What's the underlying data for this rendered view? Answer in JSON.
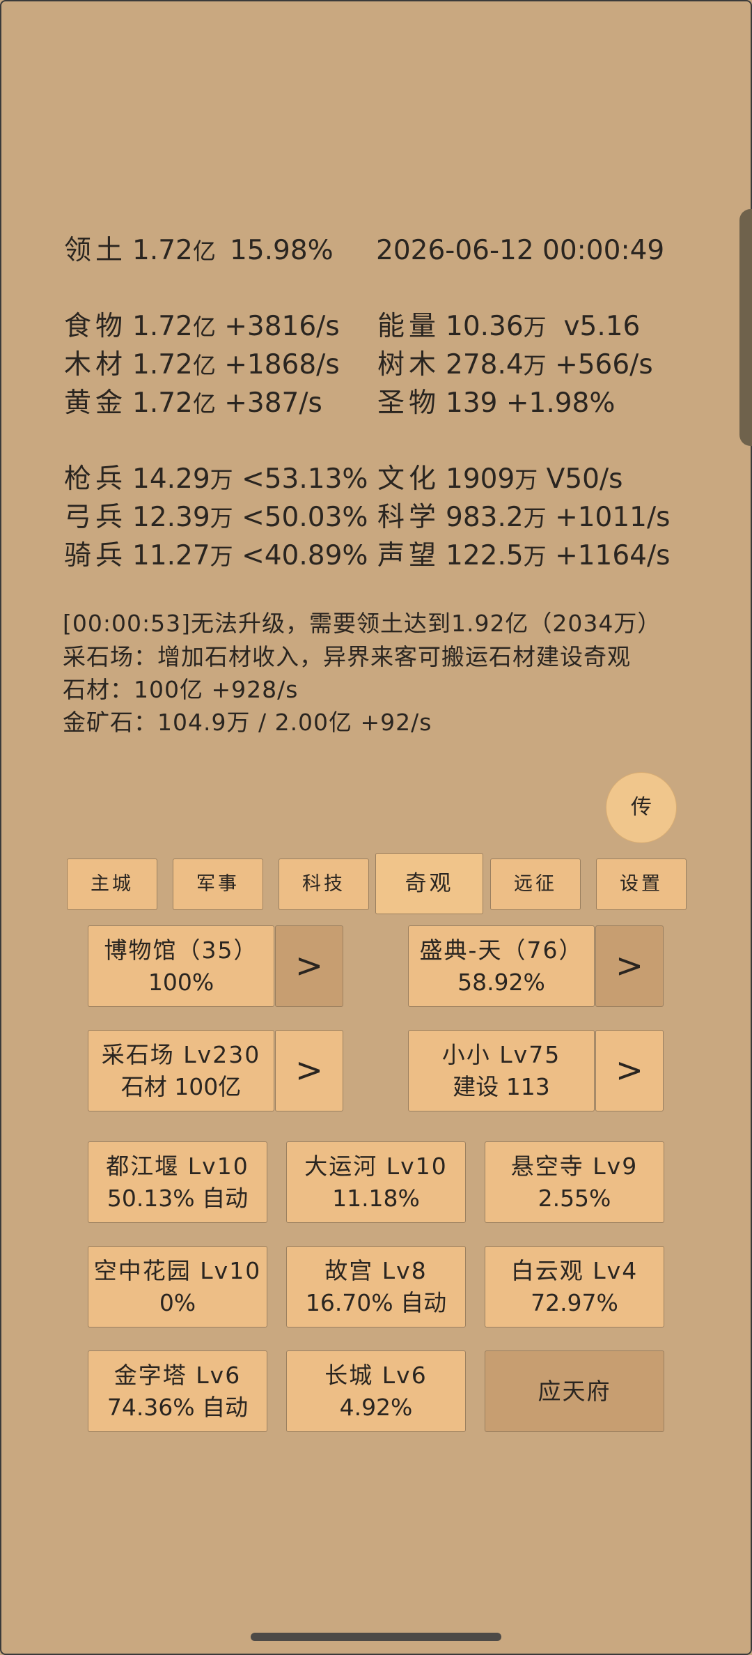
{
  "stats": {
    "territory": {
      "label": "领土",
      "value": "1.72",
      "unit": "亿",
      "extra": "15.98%"
    },
    "datetime": "2026-06-12 00:00:49",
    "food": {
      "label": "食物",
      "value": "1.72",
      "unit": "亿",
      "rate": "+3816/s"
    },
    "wood": {
      "label": "木材",
      "value": "1.72",
      "unit": "亿",
      "rate": "+1868/s"
    },
    "gold": {
      "label": "黄金",
      "value": "1.72",
      "unit": "亿",
      "rate": "+387/s"
    },
    "energy": {
      "label": "能量",
      "value": "10.36",
      "unit": "万",
      "rate": "v5.16"
    },
    "trees": {
      "label": "树木",
      "value": "278.4",
      "unit": "万",
      "rate": "+566/s"
    },
    "relics": {
      "label": "圣物",
      "value": "139",
      "unit": "",
      "rate": "+1.98%"
    },
    "spear": {
      "label": "枪兵",
      "value": "14.29",
      "unit": "万",
      "rate": "<53.13%"
    },
    "archer": {
      "label": "弓兵",
      "value": "12.39",
      "unit": "万",
      "rate": "<50.03%"
    },
    "cavalry": {
      "label": "骑兵",
      "value": "11.27",
      "unit": "万",
      "rate": "<40.89%"
    },
    "culture": {
      "label": "文化",
      "value": "1909",
      "unit": "万",
      "rate": "V50/s"
    },
    "science": {
      "label": "科学",
      "value": "983.2",
      "unit": "万",
      "rate": "+1011/s"
    },
    "prestige": {
      "label": "声望",
      "value": "122.5",
      "unit": "万",
      "rate": "+1164/s"
    }
  },
  "messages": {
    "line1": "[00:00:53]无法升级，需要领土达到1.92亿（2034万）",
    "line2": "采石场：增加石材收入，异界来客可搬运石材建设奇观",
    "line3": "石材：100亿 +928/s",
    "line4": "金矿石：104.9万 / 2.00亿 +92/s"
  },
  "round_button": "传",
  "tabs": [
    "主城",
    "军事",
    "科技",
    "奇观",
    "远征",
    "设置"
  ],
  "featured": [
    {
      "title": "博物馆（35）",
      "sub": "100%",
      "arrow": ">"
    },
    {
      "title": "盛典-天（76）",
      "sub": "58.92%",
      "arrow": ">"
    },
    {
      "title": "采石场 Lv230",
      "sub": "石材 100亿",
      "arrow": ">"
    },
    {
      "title": "小小 Lv75",
      "sub": "建设 113",
      "arrow": ">"
    }
  ],
  "wonders": [
    {
      "title": "都江堰 Lv10",
      "sub": "50.13% 自动"
    },
    {
      "title": "大运河 Lv10",
      "sub": "11.18%"
    },
    {
      "title": "悬空寺 Lv9",
      "sub": "2.55%"
    },
    {
      "title": "空中花园 Lv10",
      "sub": "0%"
    },
    {
      "title": "故宫 Lv8",
      "sub": "16.70% 自动"
    },
    {
      "title": "白云观 Lv4",
      "sub": "72.97%"
    },
    {
      "title": "金字塔 Lv6",
      "sub": "74.36% 自动"
    },
    {
      "title": "长城 Lv6",
      "sub": "4.92%"
    },
    {
      "title": "应天府",
      "sub": ""
    }
  ]
}
